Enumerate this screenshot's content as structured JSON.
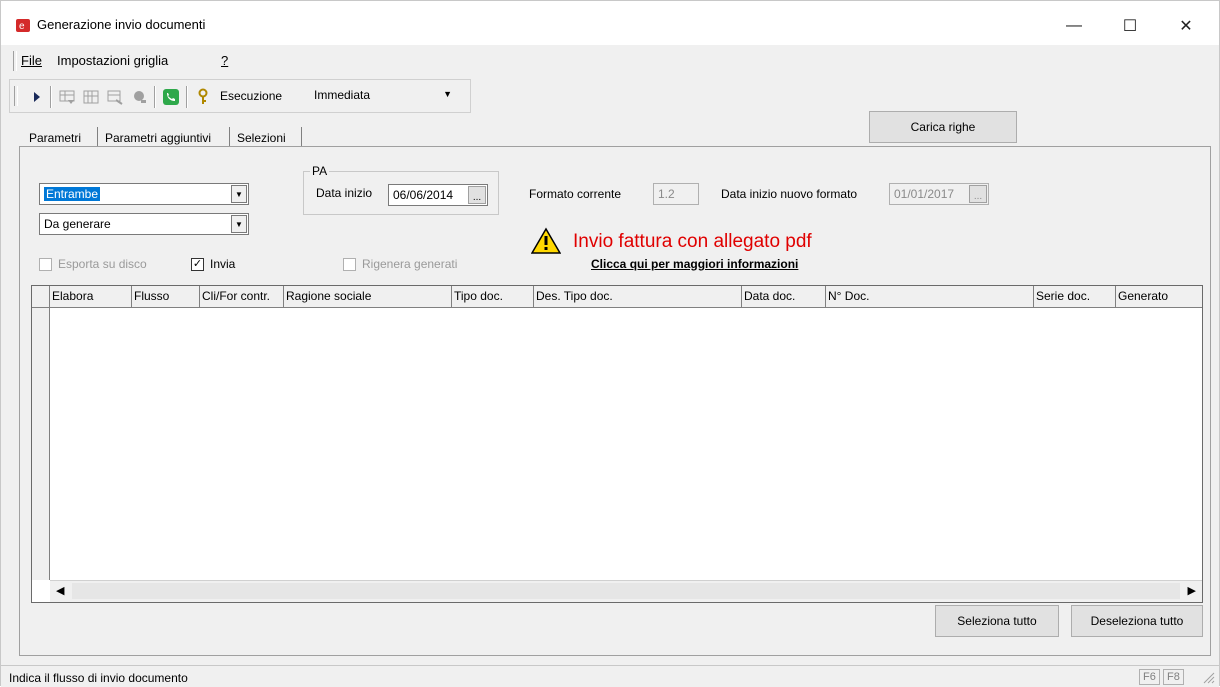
{
  "window": {
    "title": "Generazione invio documenti",
    "minimize": "—",
    "maximize": "☐",
    "close": "✕"
  },
  "menu": {
    "file": "File",
    "grid_settings": "Impostazioni griglia",
    "help": "?"
  },
  "toolbar": {
    "execution_label": "Esecuzione",
    "execution_value": "Immediata"
  },
  "tabs": [
    "Parametri",
    "Parametri aggiuntivi",
    "Selezioni"
  ],
  "load_rows_button": "Carica righe",
  "filters": {
    "flow_combo": "Entrambe",
    "status_combo": "Da generare"
  },
  "pa_group": {
    "title": "PA",
    "start_date_label": "Data inizio",
    "start_date_value": "06/06/2014"
  },
  "format": {
    "current_label": "Formato corrente",
    "current_value": "1.2",
    "new_start_label": "Data inizio nuovo formato",
    "new_start_value": "01/01/2017"
  },
  "checkboxes": {
    "export_disk": {
      "label": "Esporta su disco",
      "checked": false
    },
    "send": {
      "label": "Invia",
      "checked": true
    },
    "regenerate": {
      "label": "Rigenera generati",
      "checked": false
    }
  },
  "warning": {
    "title": "Invio fattura con allegato pdf",
    "link": "Clicca qui per maggiori informazioni"
  },
  "grid": {
    "columns": [
      "Elabora",
      "Flusso",
      "Cli/For contr.",
      "Ragione sociale",
      "Tipo doc.",
      "Des. Tipo doc.",
      "Data doc.",
      "N° Doc.",
      "Serie doc.",
      "Generato"
    ]
  },
  "buttons": {
    "select_all": "Seleziona tutto",
    "deselect_all": "Deseleziona tutto"
  },
  "status": {
    "text": "Indica il flusso di invio documento",
    "f6": "F6",
    "f8": "F8"
  },
  "colors": {
    "selection": "#0078d7",
    "warning_text": "#e00000"
  }
}
